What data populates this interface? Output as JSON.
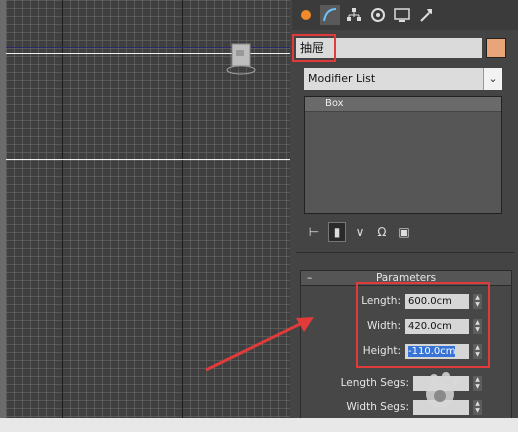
{
  "object": {
    "name": "抽屉",
    "color": "#e8a57a"
  },
  "tabs": [
    {
      "icon": "sphere-icon"
    },
    {
      "icon": "modify-icon"
    },
    {
      "icon": "hierarchy-icon"
    },
    {
      "icon": "motion-icon"
    },
    {
      "icon": "display-icon"
    },
    {
      "icon": "utilities-icon"
    }
  ],
  "modifier_list": {
    "label": "Modifier List"
  },
  "stack": {
    "items": [
      "Box"
    ]
  },
  "parameters": {
    "title": "Parameters",
    "length_label": "Length:",
    "length_value": "600.0cm",
    "width_label": "Width:",
    "width_value": "420.0cm",
    "height_label": "Height:",
    "height_value": "-110.0cm",
    "length_segs_label": "Length Segs:",
    "width_segs_label": "Width Segs:"
  },
  "colors": {
    "highlight": "#e03b3b",
    "selection": "#3874d8"
  }
}
